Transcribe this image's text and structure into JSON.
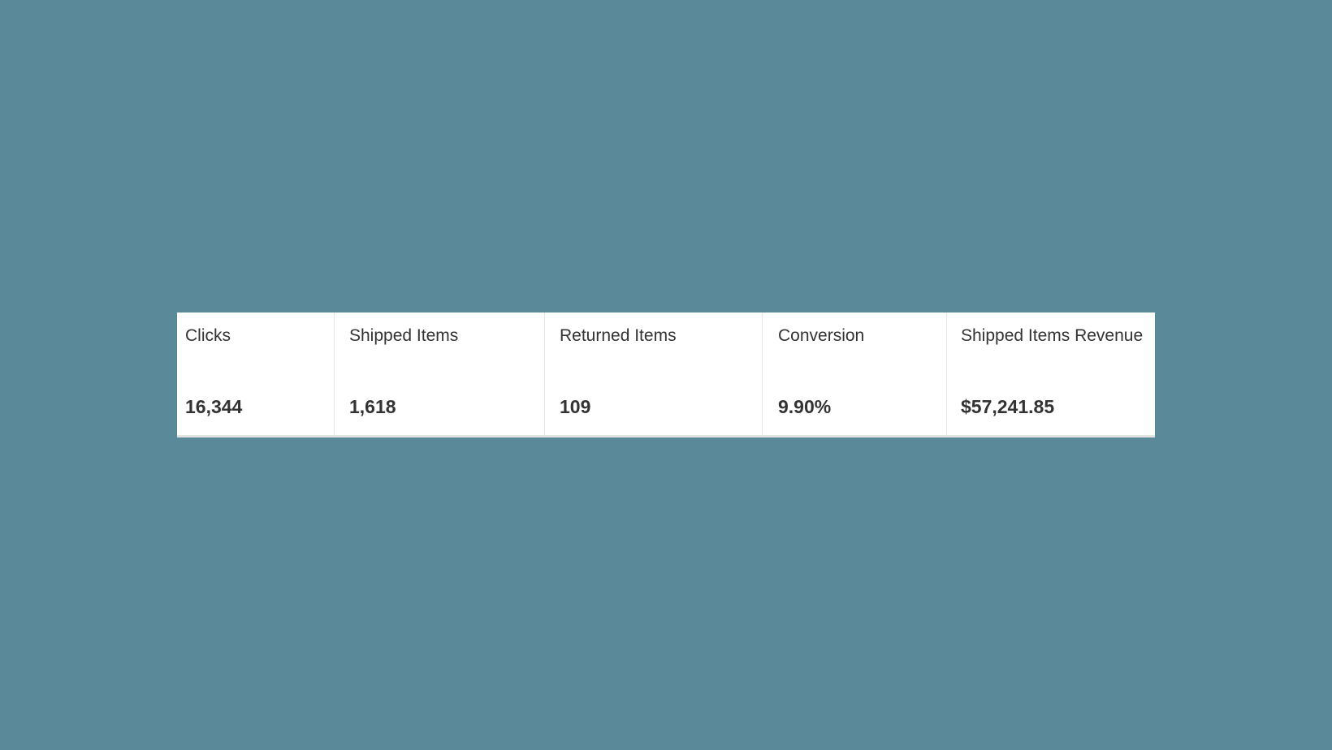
{
  "metrics": [
    {
      "label": "Clicks",
      "value": "16,344"
    },
    {
      "label": "Shipped Items",
      "value": "1,618"
    },
    {
      "label": "Returned Items",
      "value": "109"
    },
    {
      "label": "Conversion",
      "value": "9.90%"
    },
    {
      "label": "Shipped Items Revenue",
      "value": "$57,241.85"
    }
  ],
  "colors": {
    "background": "#5a8a99",
    "card": "#ffffff",
    "text": "#333333"
  }
}
